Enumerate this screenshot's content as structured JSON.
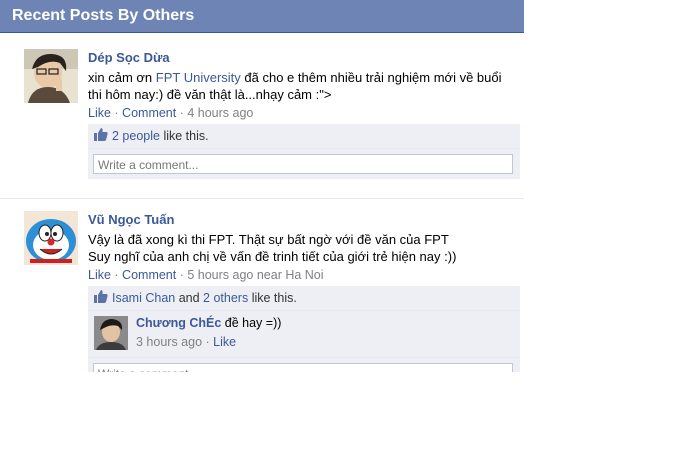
{
  "header": {
    "title": "Recent Posts By Others"
  },
  "posts": [
    {
      "author": "Dép Sọc Dừa",
      "text_before_link": "xin cảm ơn ",
      "link": "FPT University",
      "text_after_link": " đã cho e thêm nhiều trải nghiệm mới về buổi thi hôm nay:) đề văn thật là...nhạy cảm :\">",
      "like_label": "Like",
      "comment_label": "Comment",
      "time": "4 hours ago",
      "likes_link": "2 people",
      "likes_suffix": " like this.",
      "comment_placeholder": "Write a comment..."
    },
    {
      "author": "Vũ Ngọc Tuấn",
      "line1": "Vậy là đã xong kì thi FPT. Thật sự bất ngờ với đề văn của FPT",
      "line2": "Suy nghĩ của anh chị về vấn đề trinh tiết của giới trẻ hiện nay :))",
      "like_label": "Like",
      "comment_label": "Comment",
      "time": "5 hours ago near Ha Noi",
      "likes_person": "Isami Chan",
      "likes_and": " and ",
      "likes_others": "2 others",
      "likes_suffix": " like this.",
      "comment": {
        "author": "Chương ChÉc",
        "text": " đề hay =))",
        "time": "3 hours ago",
        "like_label": "Like"
      },
      "comment_placeholder": "Write a comment..."
    }
  ],
  "colors": {
    "header_bg": "#6d84b4",
    "link": "#3b5998",
    "ufi_bg": "#edeff4"
  }
}
